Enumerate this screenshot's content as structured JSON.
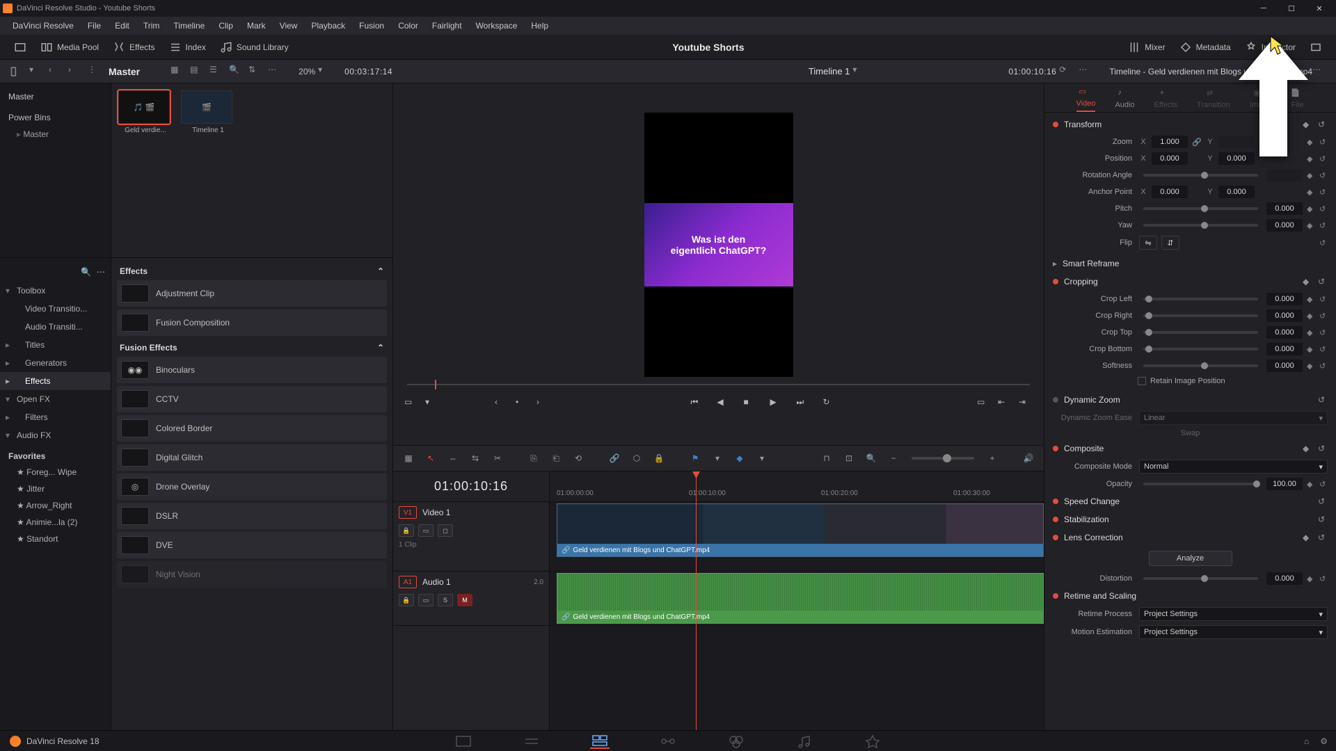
{
  "titlebar": {
    "text": "DaVinci Resolve Studio - Youtube Shorts"
  },
  "menubar": [
    "DaVinci Resolve",
    "File",
    "Edit",
    "Trim",
    "Timeline",
    "Clip",
    "Mark",
    "View",
    "Playback",
    "Fusion",
    "Color",
    "Fairlight",
    "Workspace",
    "Help"
  ],
  "top_toolbar": {
    "media_pool": "Media Pool",
    "effects": "Effects",
    "index": "Index",
    "sound_library": "Sound Library",
    "center_title": "Youtube Shorts",
    "mixer": "Mixer",
    "metadata": "Metadata",
    "inspector": "Inspector"
  },
  "secondary": {
    "master": "Master",
    "zoom_pct": "20%",
    "src_tc": "00:03:17:14",
    "timeline_name": "Timeline 1",
    "timeline_tc": "01:00:10:16",
    "inspector_title": "Timeline - Geld verdienen mit Blogs und ChatGPT.mp4"
  },
  "bins": {
    "master": "Master",
    "power_bins": "Power Bins",
    "power_master": "Master",
    "clip1": "Geld verdie...",
    "clip2": "Timeline 1"
  },
  "fx_tree": {
    "toolbox": "Toolbox",
    "video_trans": "Video Transitio...",
    "audio_trans": "Audio Transiti...",
    "titles": "Titles",
    "generators": "Generators",
    "effects": "Effects",
    "openfx": "Open FX",
    "filters": "Filters",
    "audiofx": "Audio FX",
    "favorites": "Favorites",
    "favs": [
      "Foreg... Wipe",
      "Jitter",
      "Arrow_Right",
      "Animie...la (2)",
      "Standort"
    ]
  },
  "fx_list": {
    "group1": "Effects",
    "items1": [
      "Adjustment Clip",
      "Fusion Composition"
    ],
    "group2": "Fusion Effects",
    "items2": [
      "Binoculars",
      "CCTV",
      "Colored Border",
      "Digital Glitch",
      "Drone Overlay",
      "DSLR",
      "DVE",
      "Night Vision"
    ]
  },
  "viewer": {
    "line1": "Was ist den",
    "line2": "eigentlich ChatGPT?"
  },
  "timeline": {
    "tc": "01:00:10:16",
    "ticks": [
      "01:00:00:00",
      "01:00:10:00",
      "01:00:20:00",
      "01:00:30:00"
    ],
    "v1_badge": "V1",
    "v1_name": "Video 1",
    "v1_count": "1 Clip",
    "a1_badge": "A1",
    "a1_name": "Audio 1",
    "a1_level": "2.0",
    "clip_name": "Geld verdienen mit Blogs und ChatGPT.mp4",
    "solo": "S",
    "mute": "M"
  },
  "inspector": {
    "tabs": [
      "Video",
      "Audio",
      "Effects",
      "Transition",
      "Image",
      "File"
    ],
    "transform": "Transform",
    "zoom": "Zoom",
    "zoom_x": "1.000",
    "position": "Position",
    "pos_x": "0.000",
    "pos_y": "0.000",
    "rotation": "Rotation Angle",
    "anchor": "Anchor Point",
    "anc_x": "0.000",
    "anc_y": "0.000",
    "pitch": "Pitch",
    "pitch_v": "0.000",
    "yaw": "Yaw",
    "yaw_v": "0.000",
    "flip": "Flip",
    "smart_reframe": "Smart Reframe",
    "cropping": "Cropping",
    "crop_left": "Crop Left",
    "crop_left_v": "0.000",
    "crop_right": "Crop Right",
    "crop_right_v": "0.000",
    "crop_top": "Crop Top",
    "crop_top_v": "0.000",
    "crop_bottom": "Crop Bottom",
    "crop_bottom_v": "0.000",
    "softness": "Softness",
    "softness_v": "0.000",
    "retain": "Retain Image Position",
    "dyn_zoom": "Dynamic Zoom",
    "dyn_ease": "Dynamic Zoom Ease",
    "dyn_ease_v": "Linear",
    "swap": "Swap",
    "composite": "Composite",
    "comp_mode": "Composite Mode",
    "comp_mode_v": "Normal",
    "opacity": "Opacity",
    "opacity_v": "100.00",
    "speed": "Speed Change",
    "stab": "Stabilization",
    "lens": "Lens Correction",
    "analyze": "Analyze",
    "distortion": "Distortion",
    "distortion_v": "0.000",
    "retime": "Retime and Scaling",
    "retime_proc": "Retime Process",
    "retime_proc_v": "Project Settings",
    "motion_est": "Motion Estimation",
    "motion_est_v": "Project Settings",
    "axis_x": "X",
    "axis_y": "Y"
  },
  "footer": {
    "brand": "DaVinci Resolve 18"
  }
}
